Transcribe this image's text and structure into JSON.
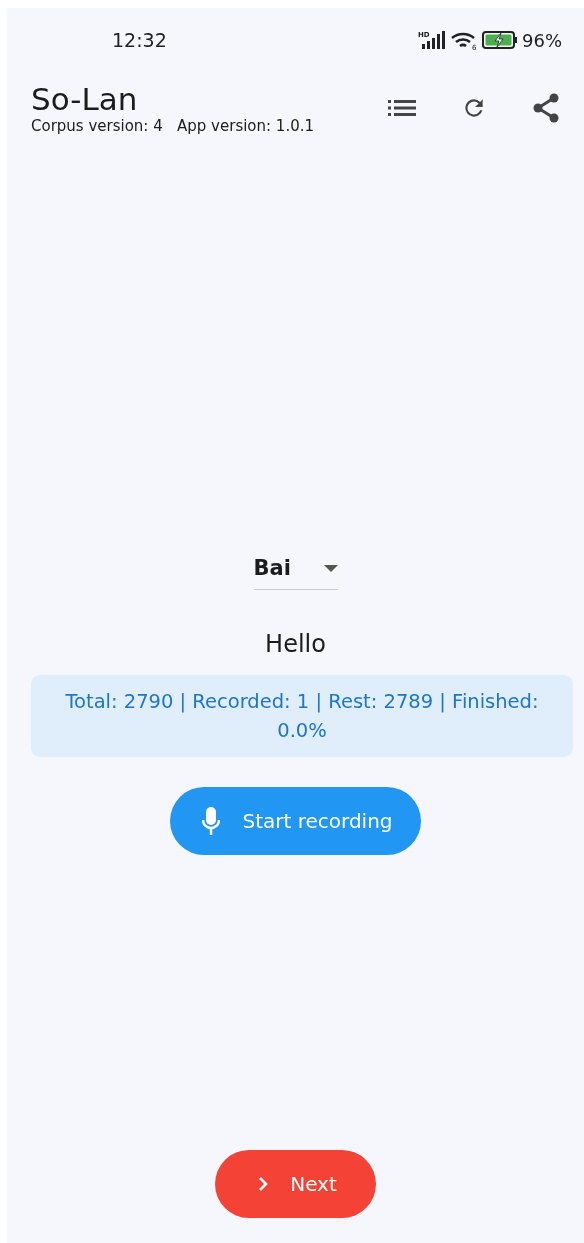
{
  "status_bar": {
    "time": "12:32",
    "network_badge": "HD",
    "wifi_badge": "6",
    "battery": "96%"
  },
  "app_bar": {
    "title": "So-Lan",
    "subtitle": "Corpus version: 4   App version: 1.0.1"
  },
  "language_dropdown": {
    "value": "Bai"
  },
  "prompt": "Hello",
  "progress_info": "Total: 2790 | Recorded: 1 | Rest: 2789 | Finished: 0.0%",
  "record_button": {
    "label": "Start recording"
  },
  "next_button": {
    "label": "Next"
  }
}
